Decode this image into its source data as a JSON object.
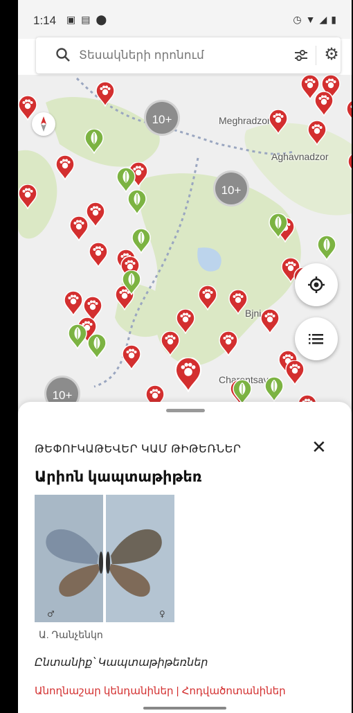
{
  "status_bar": {
    "time": "1:14",
    "left_icons": [
      "teams-icon",
      "image-icon",
      "location-icon"
    ],
    "right_icons": [
      "alarm-icon",
      "wifi-icon",
      "signal-icon",
      "battery-icon"
    ]
  },
  "search": {
    "placeholder": "Տեսակների որոնում"
  },
  "map": {
    "cluster_label": "10+",
    "place_labels": [
      "Meghradzor",
      "Aghavnadzor",
      "Bjni",
      "Charentsavan"
    ],
    "colors": {
      "animal_pin": "#d32f2f",
      "plant_pin": "#7cb342",
      "cluster": "#8c8c8c",
      "land": "#dbe8c5",
      "water": "#bcd4ec"
    }
  },
  "sheet": {
    "category": "ԹԵՓՈՒԿԱԹԵՎԵՐ ԿԱՄ ԹԻԹԵՌՆԵՐ",
    "species_name": "Արիոն կապտաթիթեռ",
    "photo_credit": "Ա. Դանչենկո",
    "family": "Ընտանիք՝ Կապտաթիթեռներ",
    "links": "Անողնաշար կենդանիներ | Հոդվածոտանիներ",
    "photo_symbols": [
      "♂",
      "♀"
    ]
  }
}
